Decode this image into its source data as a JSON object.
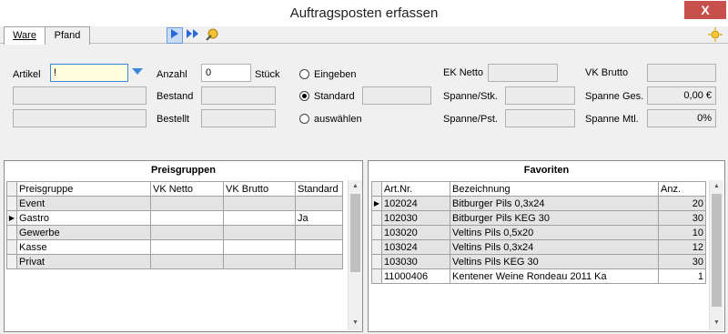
{
  "window": {
    "title": "Auftragsposten erfassen",
    "close_glyph": "X"
  },
  "tabs": [
    {
      "label": "Ware"
    },
    {
      "label": "Pfand"
    }
  ],
  "toolbar": {
    "icons": [
      "play-icon",
      "fast-forward-icon",
      "star-pointer-icon"
    ],
    "settings_icon": "sun-icon"
  },
  "form": {
    "artikel_label": "Artikel",
    "artikel_value": "!",
    "anzahl_label": "Anzahl",
    "anzahl_value": "0",
    "stueck_label": "Stück",
    "bestand_label": "Bestand",
    "bestellt_label": "Bestellt",
    "radio_eingeben": "Eingeben",
    "radio_standard": "Standard",
    "radio_auswaehlen": "auswählen",
    "ek_netto_label": "EK Netto",
    "spanne_stk_label": "Spanne/Stk.",
    "spanne_pst_label": "Spanne/Pst.",
    "vk_brutto_label": "VK Brutto",
    "spanne_ges_label": "Spanne Ges.",
    "spanne_ges_value": "0,00 €",
    "spanne_mtl_label": "Spanne Mtl.",
    "spanne_mtl_value": "0%"
  },
  "preisgruppen": {
    "title": "Preisgruppen",
    "headers": [
      "Preisgruppe",
      "VK Netto",
      "VK Brutto",
      "Standard"
    ],
    "rows": [
      {
        "name": "Event",
        "vk_netto": "",
        "vk_brutto": "",
        "standard": ""
      },
      {
        "name": "Gastro",
        "vk_netto": "",
        "vk_brutto": "",
        "standard": "Ja"
      },
      {
        "name": "Gewerbe",
        "vk_netto": "",
        "vk_brutto": "",
        "standard": ""
      },
      {
        "name": "Kasse",
        "vk_netto": "",
        "vk_brutto": "",
        "standard": ""
      },
      {
        "name": "Privat",
        "vk_netto": "",
        "vk_brutto": "",
        "standard": ""
      }
    ]
  },
  "favoriten": {
    "title": "Favoriten",
    "headers": [
      "Art.Nr.",
      "Bezeichnung",
      "Anz."
    ],
    "rows": [
      {
        "artnr": "102024",
        "bezeichnung": "Bitburger Pils 0,3x24",
        "anz": "20"
      },
      {
        "artnr": "102030",
        "bezeichnung": "Bitburger Pils KEG 30",
        "anz": "30"
      },
      {
        "artnr": "103020",
        "bezeichnung": "Veltins Pils 0,5x20",
        "anz": "10"
      },
      {
        "artnr": "103024",
        "bezeichnung": "Veltins Pils 0,3x24",
        "anz": "12"
      },
      {
        "artnr": "103030",
        "bezeichnung": "Veltins Pils KEG 30",
        "anz": "30"
      },
      {
        "artnr": "11000406",
        "bezeichnung": "Kentener Weine Rondeau 2011 Ka",
        "anz": "1"
      }
    ]
  }
}
